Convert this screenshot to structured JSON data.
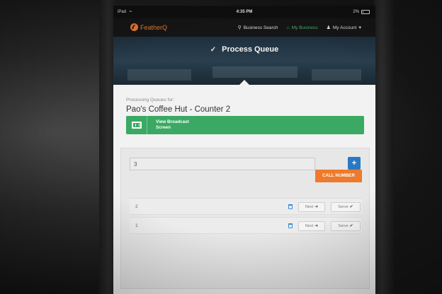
{
  "status_bar": {
    "device": "iPad",
    "wifi_icon": "wifi-icon",
    "time": "4:35 PM",
    "battery_text": "2%",
    "battery_icon": "battery-icon"
  },
  "navbar": {
    "brand": "FeatherQ",
    "brand_color": "#e8772e",
    "items": [
      {
        "label": "Business Search",
        "icon": "search-icon"
      },
      {
        "label": "My Business",
        "icon": "home-icon",
        "active": true,
        "color": "#3fae66"
      },
      {
        "label": "My Account",
        "icon": "user-icon",
        "dropdown": true
      }
    ]
  },
  "hero": {
    "title": "Process Queue",
    "icon": "process-queue-icon"
  },
  "processing": {
    "label": "Processing Queues for:",
    "business": "Pao's Coffee Hut - Counter 2",
    "broadcast_button": "View Broadcast Screen",
    "broadcast_line1": "View Broadcast",
    "broadcast_line2": "Screen",
    "broadcast_color": "#3aa964"
  },
  "queue_controls": {
    "number_input_value": "3",
    "add_button_label": "+",
    "add_button_color": "#2b78c2",
    "call_button_label": "CALL NUMBER",
    "call_button_color": "#ee7a2b"
  },
  "queue": {
    "rows": [
      {
        "number": "2",
        "next_label": "Next",
        "serve_label": "Serve"
      },
      {
        "number": "1",
        "next_label": "Next",
        "serve_label": "Serve"
      }
    ]
  }
}
